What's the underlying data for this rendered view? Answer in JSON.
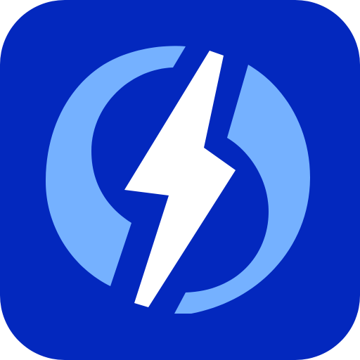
{
  "icon": {
    "name": "lightning-bolt-app-icon",
    "colors": {
      "tile": "#0328BE",
      "ring": "#75B1FF",
      "bolt": "#FFFFFF"
    }
  }
}
